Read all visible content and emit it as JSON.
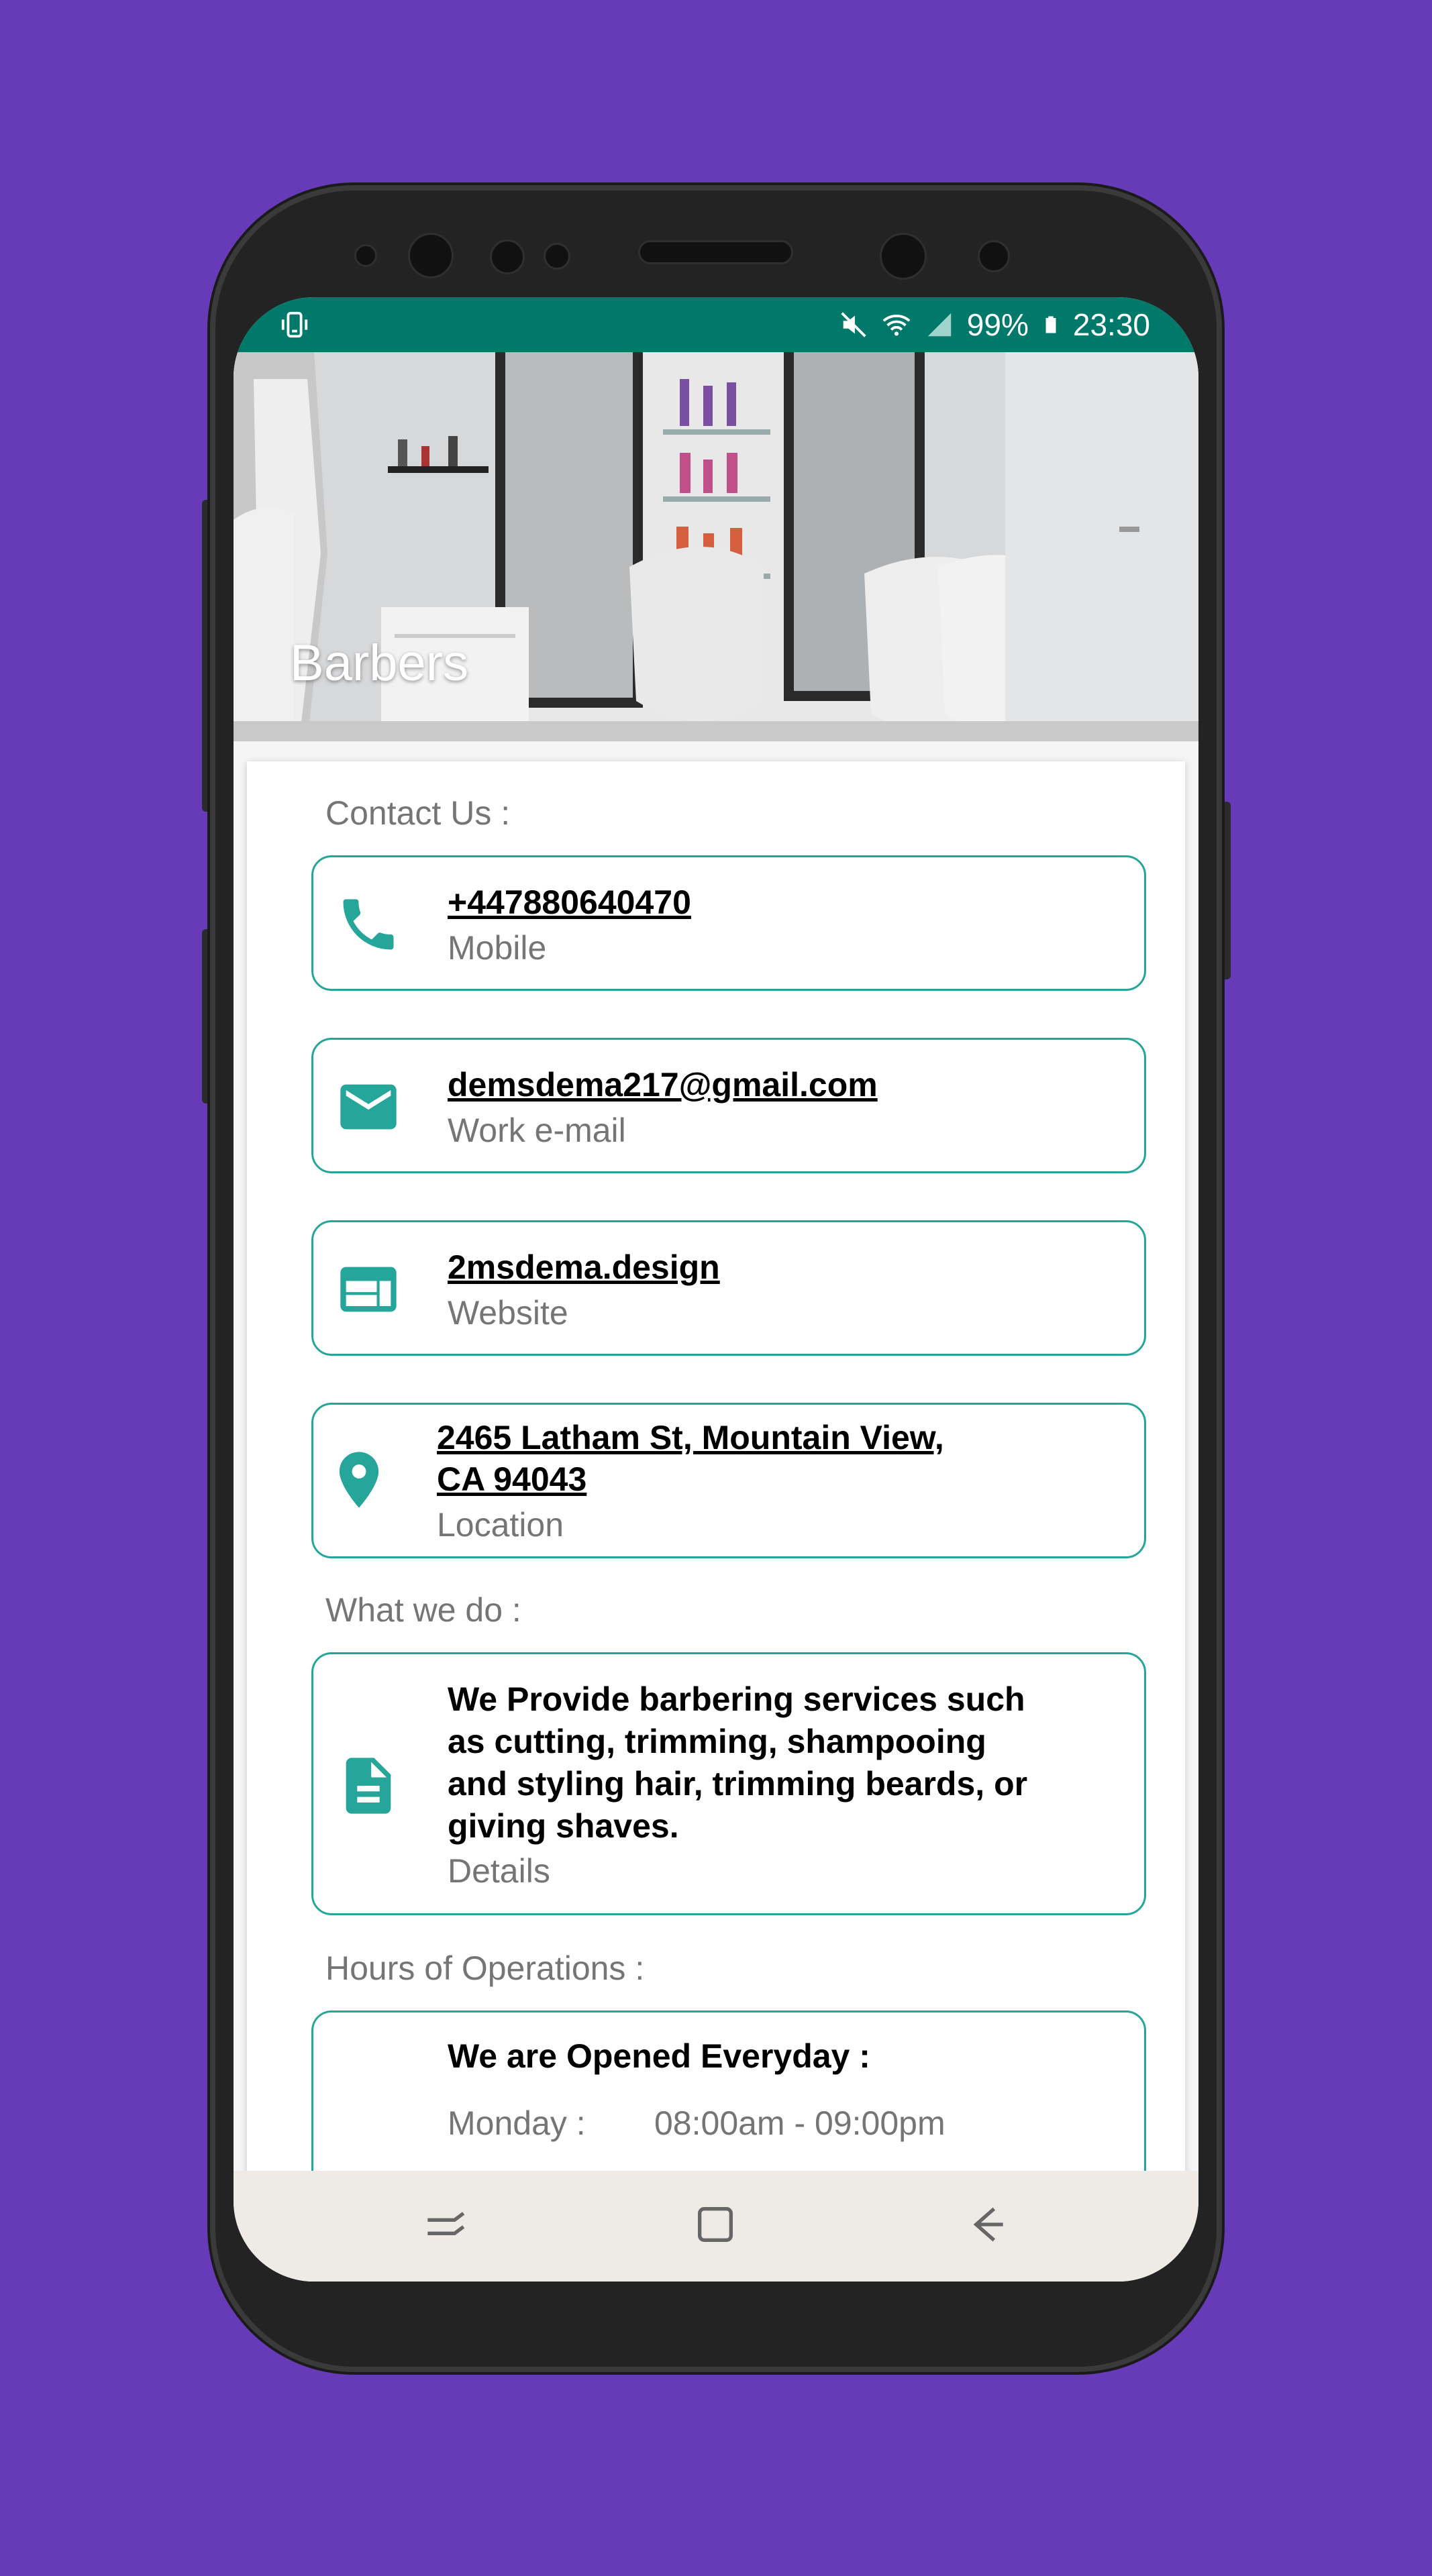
{
  "status_bar": {
    "battery": "99%",
    "time": "23:30",
    "icons": [
      "vibrate-icon",
      "mute-icon",
      "wifi-icon",
      "signal-icon",
      "battery-icon"
    ]
  },
  "header": {
    "title": "Barbers"
  },
  "contact": {
    "section_label": "Contact Us :",
    "items": [
      {
        "icon": "phone-icon",
        "value": "+447880640470",
        "label": "Mobile"
      },
      {
        "icon": "email-icon",
        "value": "demsdema217@gmail.com",
        "label": "Work e-mail"
      },
      {
        "icon": "web-icon",
        "value": "2msdema.design",
        "label": "Website"
      },
      {
        "icon": "location-icon",
        "value_line1": "2465 Latham St, Mountain View,",
        "value_line2": "CA 94043",
        "label": "Location"
      }
    ]
  },
  "what_we_do": {
    "section_label": "What we do :",
    "description": "We Provide barbering services such as cutting, trimming, shampooing and styling hair, trimming beards, or giving shaves.",
    "label": "Details",
    "icon": "document-icon"
  },
  "hours": {
    "section_label": "Hours of Operations :",
    "title": "We are Opened Everyday :",
    "rows": [
      {
        "day": "Monday :",
        "time": "08:00am - 09:00pm"
      }
    ]
  },
  "colors": {
    "background": "#673ab7",
    "status_bar": "#00796b",
    "accent": "#26a69a",
    "nav_bar": "#eeeae6"
  }
}
